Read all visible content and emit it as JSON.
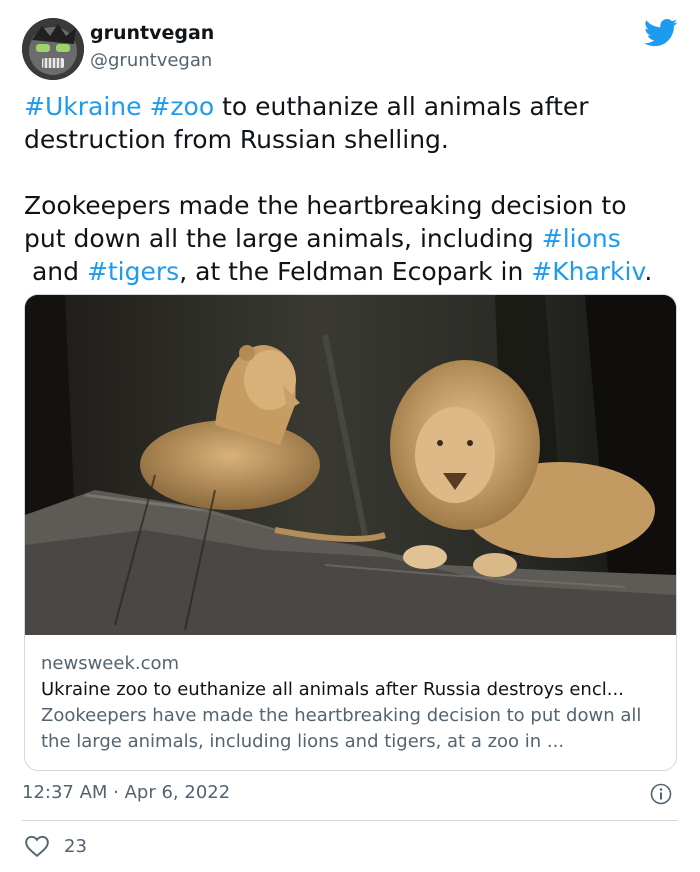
{
  "author": {
    "display_name": "gruntvegan",
    "handle": "@gruntvegan"
  },
  "tweet": {
    "segments": [
      {
        "text": "#Ukraine",
        "tag": true
      },
      {
        "text": " ",
        "tag": false
      },
      {
        "text": "#zoo",
        "tag": true
      },
      {
        "text": " to euthanize all animals after\ndestruction from Russian shelling.\n\nZookeepers made the heartbreaking decision to\nput down all the large animals, including ",
        "tag": false
      },
      {
        "text": "#lions",
        "tag": true
      },
      {
        "text": "\n and ",
        "tag": false
      },
      {
        "text": "#tigers",
        "tag": true
      },
      {
        "text": ", at the Feldman Ecopark in ",
        "tag": false
      },
      {
        "text": "#Kharkiv",
        "tag": true
      },
      {
        "text": ".",
        "tag": false
      }
    ]
  },
  "card": {
    "domain": "newsweek.com",
    "title": "Ukraine zoo to euthanize all animals after Russia destroys encl...",
    "description": "Zookeepers have made the heartbreaking decision to put down all the large animals, including lions and tigers, at a zoo in ..."
  },
  "meta": {
    "timestamp": "12:37 AM · Apr 6, 2022",
    "like_count": "23"
  },
  "colors": {
    "accent": "#1d9bf0",
    "secondary_text": "#536471",
    "border": "#cfd9de"
  },
  "icons": [
    "twitter-bird-icon",
    "info-icon",
    "heart-icon"
  ]
}
